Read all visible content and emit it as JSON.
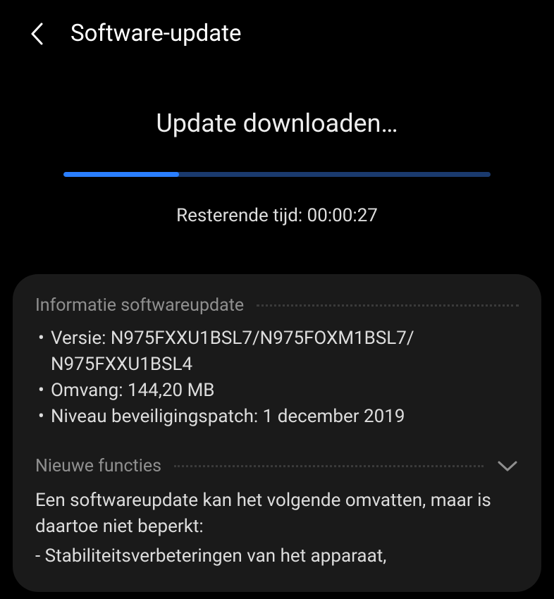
{
  "header": {
    "title": "Software-update"
  },
  "progress": {
    "title": "Update downloaden…",
    "percent": 27,
    "remaining_label": "Resterende tijd: 00:00:27"
  },
  "info": {
    "section_label": "Informatie softwareupdate",
    "version_line": "Versie: N975FXXU1BSL7/N975FOXM1BSL7/ N975FXXU1BSL4",
    "size_line": "Omvang: 144,20 MB",
    "patch_line": "Niveau beveiligingspatch: 1 december 2019"
  },
  "features": {
    "section_label": "Nieuwe functies",
    "intro": "Een softwareupdate kan het volgende omvatten, maar is daartoe niet beperkt:",
    "item1": " - Stabiliteitsverbeteringen van het apparaat,"
  }
}
